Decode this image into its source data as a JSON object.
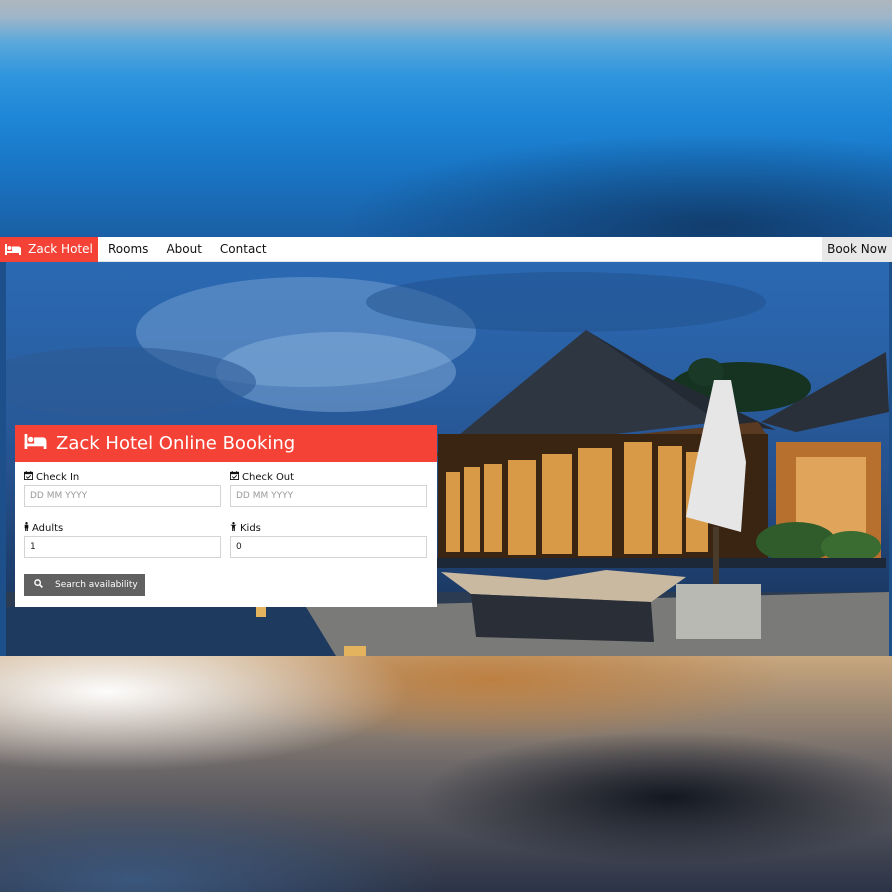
{
  "navbar": {
    "brand_label": "Zack Hotel",
    "links": [
      "Rooms",
      "About",
      "Contact"
    ],
    "book_now_label": "Book Now"
  },
  "booking": {
    "title": "Zack Hotel Online Booking",
    "check_in": {
      "label": "Check In",
      "placeholder": "DD MM YYYY"
    },
    "check_out": {
      "label": "Check Out",
      "placeholder": "DD MM YYYY"
    },
    "adults": {
      "label": "Adults",
      "value": "1"
    },
    "kids": {
      "label": "Kids",
      "value": "0"
    },
    "search_label": "Search availability"
  },
  "colors": {
    "accent": "#f44336",
    "button": "#616161",
    "book_now_bg": "#e8e8e8"
  },
  "icons": {
    "brand": "bed-icon",
    "card_title": "bed-icon",
    "check_in": "calendar-check-icon",
    "check_out": "calendar-check-icon",
    "adults": "male-icon",
    "kids": "child-icon",
    "search": "search-icon"
  }
}
